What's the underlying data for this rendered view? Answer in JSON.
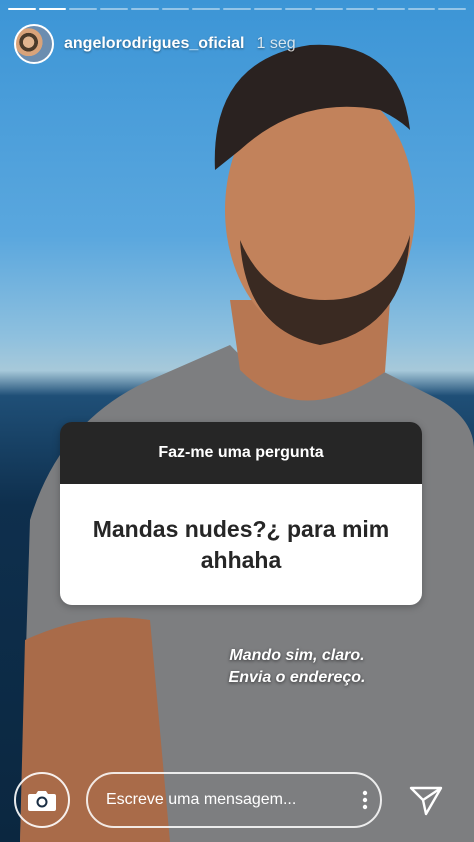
{
  "story": {
    "segments_total": 15,
    "segments_done": 2,
    "username": "angelorodrigues_oficial",
    "timestamp": "1 seg"
  },
  "question_sticker": {
    "header": "Faz-me uma pergunta",
    "question": "Mandas nudes?¿ para mim ahhaha"
  },
  "answer": {
    "line1": "Mando sim, claro.",
    "line2": "Envia o endereço."
  },
  "reply_bar": {
    "placeholder": "Escreve uma mensagem..."
  },
  "icons": [
    "camera-icon",
    "more-vertical-icon",
    "send-icon"
  ]
}
